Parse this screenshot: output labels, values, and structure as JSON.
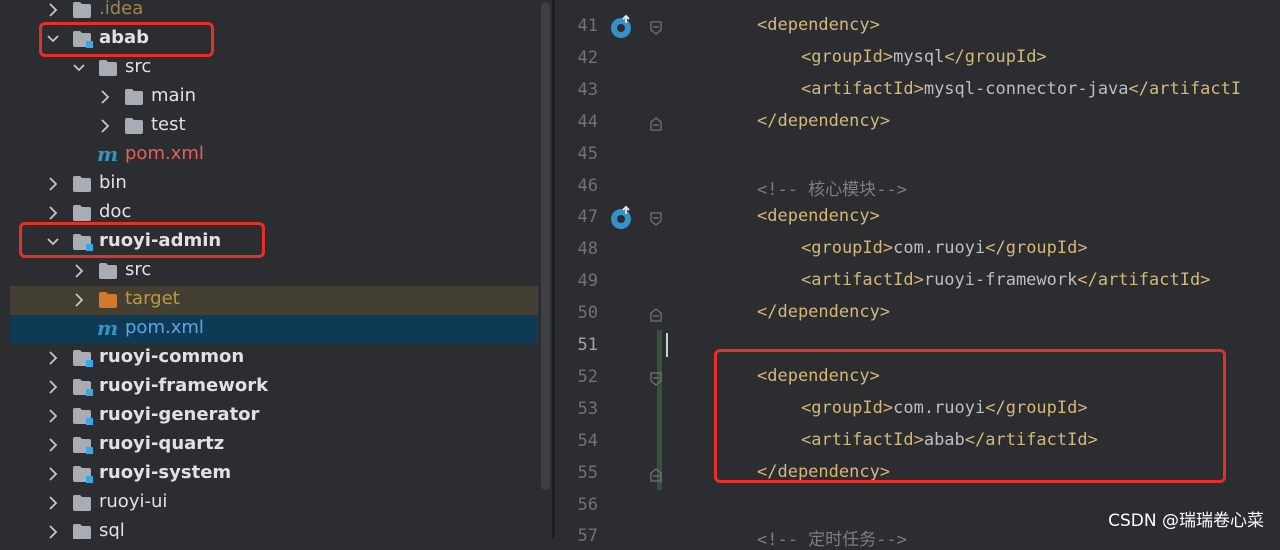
{
  "project_tree": {
    "rows": [
      {
        "label": ".idea",
        "icon": "folder-icon"
      },
      {
        "label": "abab",
        "icon": "module-folder-icon"
      },
      {
        "label": "src",
        "icon": "folder-icon"
      },
      {
        "label": "main",
        "icon": "folder-icon"
      },
      {
        "label": "test",
        "icon": "folder-icon"
      },
      {
        "label": "pom.xml",
        "icon": "maven-icon"
      },
      {
        "label": "bin",
        "icon": "folder-icon"
      },
      {
        "label": "doc",
        "icon": "folder-icon"
      },
      {
        "label": "ruoyi-admin",
        "icon": "module-folder-icon"
      },
      {
        "label": "src",
        "icon": "folder-icon"
      },
      {
        "label": "target",
        "icon": "excluded-folder-icon"
      },
      {
        "label": "pom.xml",
        "icon": "maven-icon"
      },
      {
        "label": "ruoyi-common",
        "icon": "module-folder-icon"
      },
      {
        "label": "ruoyi-framework",
        "icon": "module-folder-icon"
      },
      {
        "label": "ruoyi-generator",
        "icon": "module-folder-icon"
      },
      {
        "label": "ruoyi-quartz",
        "icon": "module-folder-icon"
      },
      {
        "label": "ruoyi-system",
        "icon": "module-folder-icon"
      },
      {
        "label": "ruoyi-ui",
        "icon": "folder-icon"
      },
      {
        "label": "sql",
        "icon": "folder-icon"
      }
    ]
  },
  "editor": {
    "lines": [
      {
        "num": "41",
        "parts": [
          {
            "t": "<dependency>",
            "c": "tag"
          }
        ]
      },
      {
        "num": "42",
        "parts": [
          {
            "t": "<groupId>",
            "c": "tag"
          },
          {
            "t": "mysql",
            "c": "txt"
          },
          {
            "t": "</groupId>",
            "c": "tag"
          }
        ]
      },
      {
        "num": "43",
        "parts": [
          {
            "t": "<artifactId>",
            "c": "tag"
          },
          {
            "t": "mysql-connector-java",
            "c": "txt"
          },
          {
            "t": "</artifactI",
            "c": "tag"
          }
        ]
      },
      {
        "num": "44",
        "parts": [
          {
            "t": "</dependency>",
            "c": "tag"
          }
        ]
      },
      {
        "num": "45",
        "parts": []
      },
      {
        "num": "46",
        "parts": [
          {
            "t": "<!-- 核心模块-->",
            "c": "cmt"
          }
        ]
      },
      {
        "num": "47",
        "parts": [
          {
            "t": "<dependency>",
            "c": "tag"
          }
        ]
      },
      {
        "num": "48",
        "parts": [
          {
            "t": "<groupId>",
            "c": "tag"
          },
          {
            "t": "com.ruoyi",
            "c": "txt"
          },
          {
            "t": "</groupId>",
            "c": "tag"
          }
        ]
      },
      {
        "num": "49",
        "parts": [
          {
            "t": "<artifactId>",
            "c": "tag"
          },
          {
            "t": "ruoyi-framework",
            "c": "txt"
          },
          {
            "t": "</artifactId>",
            "c": "tag"
          }
        ]
      },
      {
        "num": "50",
        "parts": [
          {
            "t": "</dependency>",
            "c": "tag"
          }
        ]
      },
      {
        "num": "51",
        "parts": []
      },
      {
        "num": "52",
        "parts": [
          {
            "t": "<dependency>",
            "c": "tag"
          }
        ]
      },
      {
        "num": "53",
        "parts": [
          {
            "t": "<groupId>",
            "c": "tag"
          },
          {
            "t": "com.ruoyi",
            "c": "txt"
          },
          {
            "t": "</groupId>",
            "c": "tag"
          }
        ]
      },
      {
        "num": "54",
        "parts": [
          {
            "t": "<artifactId>",
            "c": "tag"
          },
          {
            "t": "abab",
            "c": "txt"
          },
          {
            "t": "</artifactId>",
            "c": "tag"
          }
        ]
      },
      {
        "num": "55",
        "parts": [
          {
            "t": "</dependency>",
            "c": "tag"
          }
        ]
      },
      {
        "num": "56",
        "parts": []
      },
      {
        "num": "57",
        "parts": [
          {
            "t": "<!-- 定时任务-->",
            "c": "cmt"
          }
        ]
      }
    ]
  },
  "watermark": "CSDN @瑞瑞卷心菜",
  "colors": {
    "xml_tag": "#d5b778",
    "xml_text": "#bcbec4",
    "comment": "#7a7e85",
    "selection": "#0e3a55",
    "highlight_box": "#e5302a"
  }
}
